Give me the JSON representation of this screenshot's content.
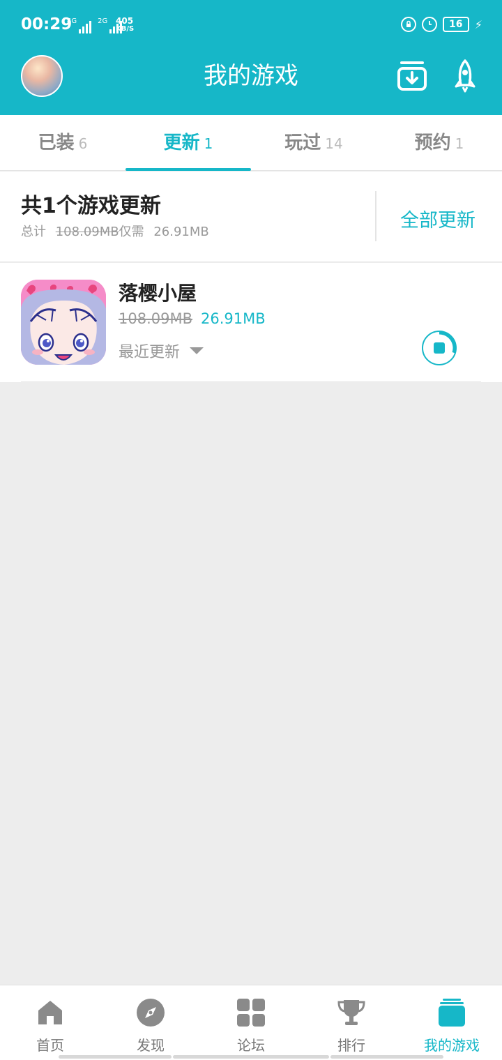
{
  "status_bar": {
    "time": "00:29",
    "net1": "4G",
    "net2": "2G",
    "speed_value": "405",
    "speed_unit": "KB/S",
    "battery": "16"
  },
  "header": {
    "title": "我的游戏",
    "accent_color": "#16b7c8"
  },
  "tabs": [
    {
      "label": "已装",
      "count": "6"
    },
    {
      "label": "更新",
      "count": "1",
      "active": true
    },
    {
      "label": "玩过",
      "count": "14"
    },
    {
      "label": "预约",
      "count": "1"
    }
  ],
  "summary": {
    "title": "共1个游戏更新",
    "total_prefix": "总计",
    "original_size": "108.09MB",
    "need_prefix": "仅需",
    "need_size": "26.91MB",
    "update_all_label": "全部更新"
  },
  "games": [
    {
      "name": "落樱小屋",
      "old_size": "108.09MB",
      "new_size": "26.91MB",
      "recent_label": "最近更新",
      "download_progress": 0.3
    }
  ],
  "bottom_nav": [
    {
      "label": "首页",
      "icon": "home-icon"
    },
    {
      "label": "发现",
      "icon": "compass-icon"
    },
    {
      "label": "论坛",
      "icon": "grid-icon"
    },
    {
      "label": "排行",
      "icon": "trophy-icon"
    },
    {
      "label": "我的游戏",
      "icon": "game-stack-icon",
      "active": true
    }
  ]
}
